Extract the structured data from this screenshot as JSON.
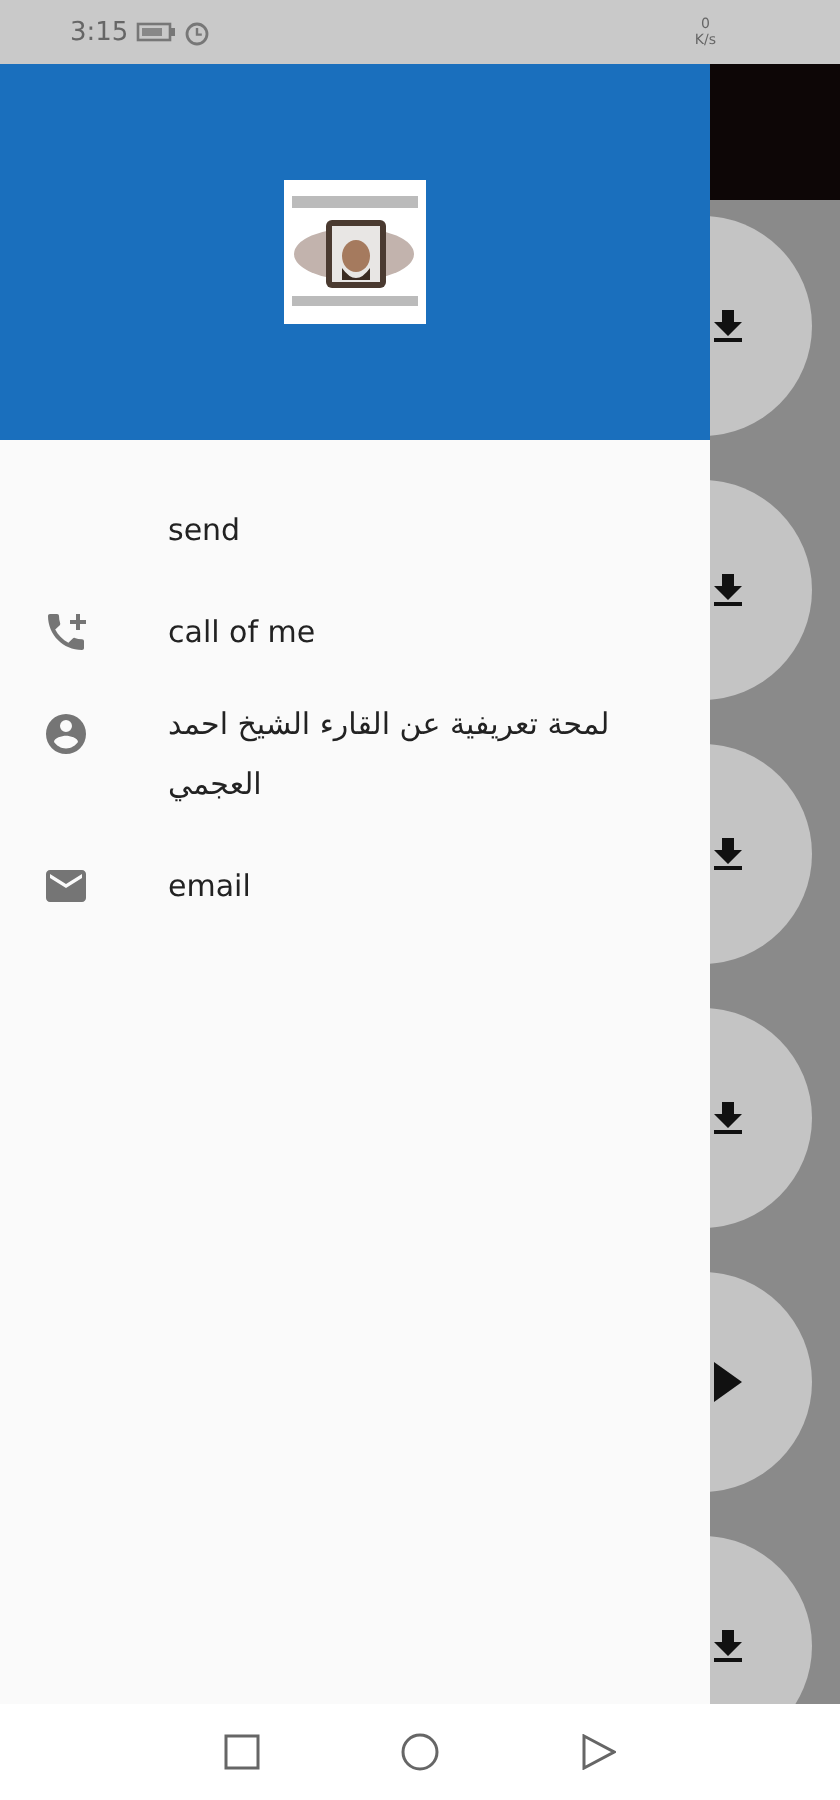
{
  "status_bar": {
    "time": "3:15",
    "net_speed": "0",
    "net_unit": "K/s"
  },
  "drawer": {
    "items": [
      {
        "label": "send",
        "kind": "plain"
      },
      {
        "label": "call of me",
        "kind": "call"
      },
      {
        "label": "لمحة تعريفية عن القارء الشيخ احمد العجمي",
        "kind": "profile"
      },
      {
        "label": "email",
        "kind": "email"
      }
    ]
  },
  "background_list": {
    "items": [
      {
        "kind": "download"
      },
      {
        "kind": "download"
      },
      {
        "kind": "download"
      },
      {
        "kind": "download"
      },
      {
        "kind": "play"
      },
      {
        "kind": "download"
      }
    ]
  }
}
